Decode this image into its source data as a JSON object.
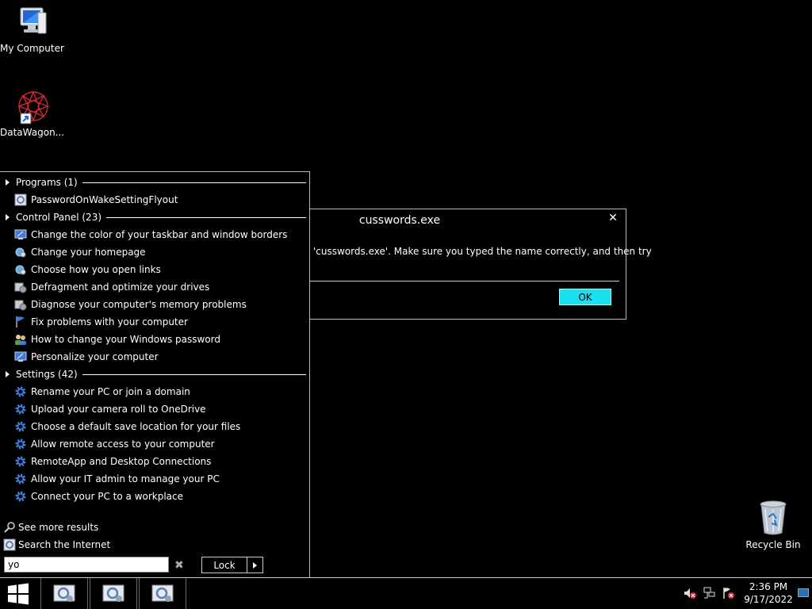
{
  "desktop": {
    "icons": [
      {
        "label": "My Computer"
      },
      {
        "label": "DataWagon..."
      },
      {
        "label": "Recycle Bin"
      }
    ]
  },
  "start_menu": {
    "groups": {
      "programs": {
        "header": "Programs (1)",
        "items": [
          "PasswordOnWakeSettingFlyout"
        ]
      },
      "control_panel": {
        "header": "Control Panel (23)",
        "items": [
          "Change the color of your taskbar and window borders",
          "Change your homepage",
          "Choose how you open links",
          "Defragment and optimize your drives",
          "Diagnose your computer's memory problems",
          "Fix problems with your computer",
          "How to change your Windows password",
          "Personalize your computer"
        ]
      },
      "settings": {
        "header": "Settings (42)",
        "items": [
          "Rename your PC or join a domain",
          "Upload your camera roll to OneDrive",
          "Choose a default save location for your files",
          "Allow remote access to your computer",
          "RemoteApp and Desktop Connections",
          "Allow your IT admin to manage your PC",
          "Connect your PC to a workplace"
        ]
      }
    },
    "see_more": "See more results",
    "search_internet": "Search the Internet",
    "search_value": "yo",
    "clear_glyph": "✖",
    "lock_label": "Lock"
  },
  "dialog": {
    "title": "cusswords.exe",
    "message": "'cusswords.exe'. Make sure you typed the name correctly, and then try",
    "close_glyph": "✕",
    "ok_label": "OK"
  },
  "taskbar": {
    "clock_time": "2:36 PM",
    "clock_date": "9/17/2022"
  },
  "colors": {
    "ok_button": "#1ae0f0",
    "background": "#000000",
    "gear_blue": "#3d7bd9"
  }
}
